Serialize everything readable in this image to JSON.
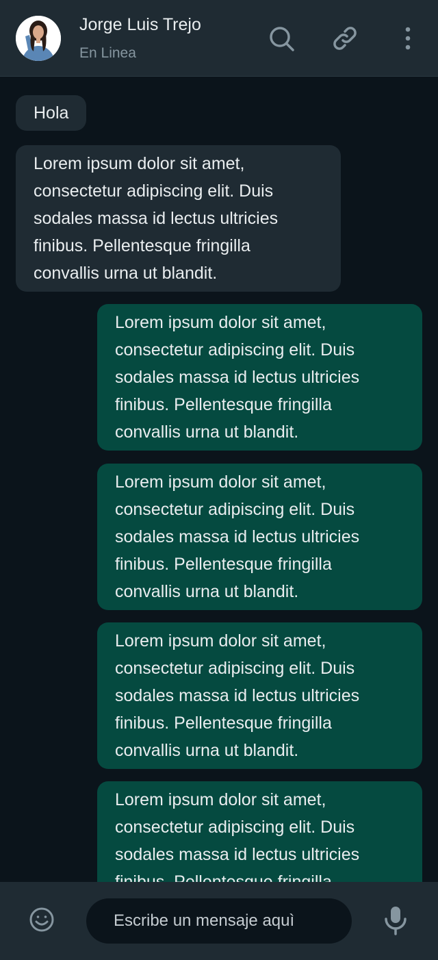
{
  "header": {
    "contact_name": "Jorge Luis Trejo",
    "status": "En Linea",
    "icons": [
      "avatar",
      "search-icon",
      "link-icon",
      "more-vertical-icon"
    ]
  },
  "messages": [
    {
      "direction": "incoming",
      "text": "Hola"
    },
    {
      "direction": "incoming",
      "text": "Lorem ipsum dolor sit amet,\nconsectetur adipiscing elit. Duis\nsodales massa id lectus ultricies\nfinibus. Pellentesque fringilla\nconvallis urna ut blandit."
    },
    {
      "direction": "outgoing",
      "text": "Lorem ipsum dolor sit amet,\nconsectetur adipiscing elit. Duis\nsodales massa id lectus ultricies\nfinibus. Pellentesque fringilla\nconvallis urna ut blandit."
    },
    {
      "direction": "outgoing",
      "text": "Lorem ipsum dolor sit amet,\nconsectetur adipiscing elit. Duis\nsodales massa id lectus ultricies\nfinibus. Pellentesque fringilla\nconvallis urna ut blandit."
    },
    {
      "direction": "outgoing",
      "text": "Lorem ipsum dolor sit amet,\nconsectetur adipiscing elit. Duis\nsodales massa id lectus ultricies\nfinibus. Pellentesque fringilla\nconvallis urna ut blandit."
    },
    {
      "direction": "outgoing",
      "text": "Lorem ipsum dolor sit amet,\nconsectetur adipiscing elit. Duis\nsodales massa id lectus ultricies\nfinibus. Pellentesque fringilla\nconvallis urna ut blandit."
    }
  ],
  "composer": {
    "placeholder": "Escribe un mensaje aquì",
    "icons": [
      "emoji-icon",
      "microphone-icon"
    ]
  },
  "colors": {
    "header_bg": "#1f2b33",
    "chat_bg": "#0b141b",
    "incoming_bubble": "#1f2b33",
    "outgoing_bubble": "#054a40",
    "secondary_text": "#8696a0",
    "icon": "#8696a0"
  }
}
